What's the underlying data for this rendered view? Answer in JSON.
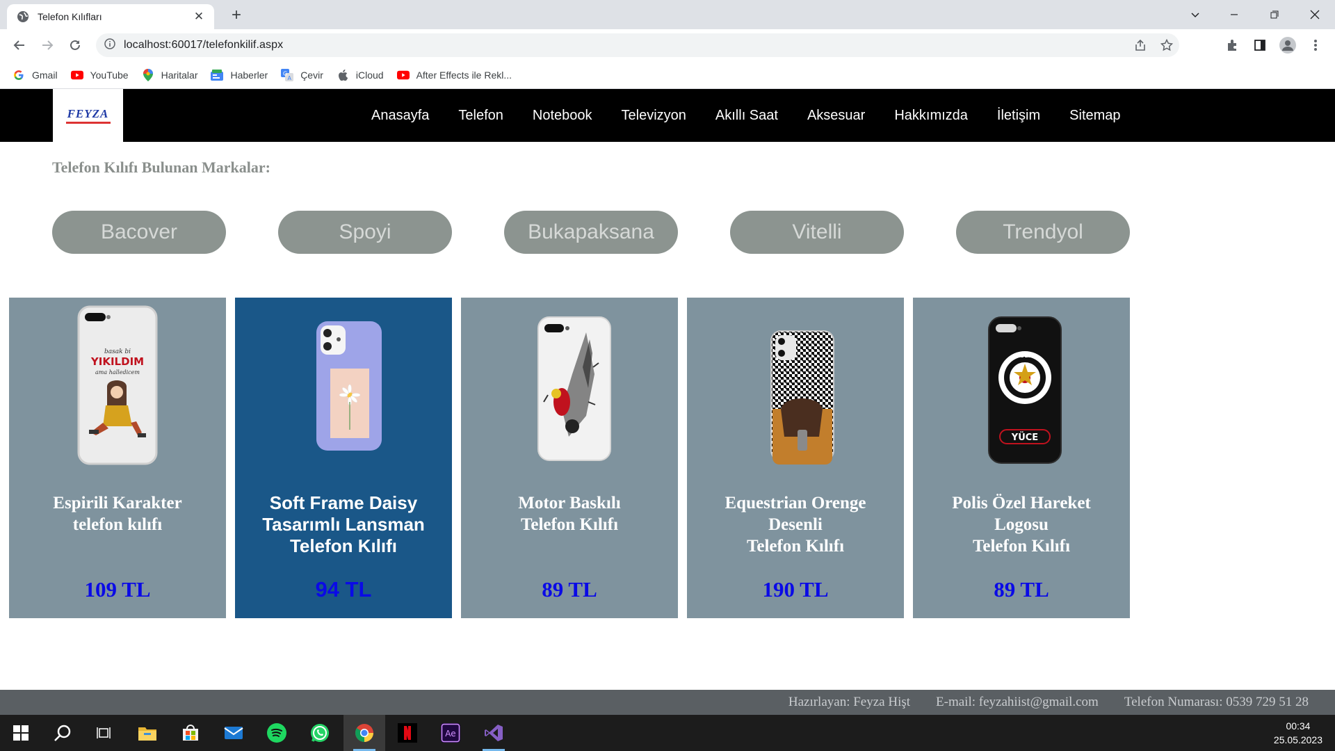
{
  "browser": {
    "tab_title": "Telefon Kılıfları",
    "tab_close": "✕",
    "new_tab": "+",
    "url": "localhost:60017/telefonkilif.aspx",
    "bookmarks": [
      {
        "label": "Gmail",
        "icon": "google-icon"
      },
      {
        "label": "YouTube",
        "icon": "youtube-icon"
      },
      {
        "label": "Haritalar",
        "icon": "maps-icon"
      },
      {
        "label": "Haberler",
        "icon": "news-icon"
      },
      {
        "label": "Çevir",
        "icon": "translate-icon"
      },
      {
        "label": "iCloud",
        "icon": "apple-icon"
      },
      {
        "label": "After Effects ile Rekl...",
        "icon": "youtube-icon"
      }
    ]
  },
  "site": {
    "logo_text": "FEYZA",
    "nav": [
      "Anasayfa",
      "Telefon",
      "Notebook",
      "Televizyon",
      "Akıllı Saat",
      "Aksesuar",
      "Hakkımızda",
      "İletişim",
      "Sitemap"
    ],
    "brands_title": "Telefon Kılıfı Bulunan Markalar:",
    "brands": [
      "Bacover",
      "Spoyi",
      "Bukapaksana",
      "Vitelli",
      "Trendyol"
    ],
    "products": [
      {
        "title": "Espirili Karakter\ntelefon kılıfı",
        "price": "109 TL",
        "case_text": "YIKILDIM"
      },
      {
        "title": "Soft Frame Daisy\nTasarımlı Lansman\nTelefon Kılıfı",
        "price": "94 TL"
      },
      {
        "title": "Motor Baskılı\nTelefon Kılıfı",
        "price": "89 TL"
      },
      {
        "title": "Equestrian Orenge\nDesenli\nTelefon Kılıfı",
        "price": "190 TL"
      },
      {
        "title": "Polis Özel Hareket\nLogosu\nTelefon Kılıfı",
        "price": "89 TL",
        "case_text": "YÜCE"
      }
    ],
    "footer": {
      "author": "Hazırlayan: Feyza Hişt",
      "email": "E-mail: feyzahiist@gmail.com",
      "phone": "Telefon Numarası: 0539 729 51 28"
    }
  },
  "taskbar": {
    "time": "00:34",
    "date": "25.05.2023"
  },
  "colors": {
    "nav_bg": "#000000",
    "card_bg": "#7f939e",
    "card_active_bg": "#1a5788",
    "price": "#0a0ae6",
    "brand_btn": "#8c9490"
  }
}
